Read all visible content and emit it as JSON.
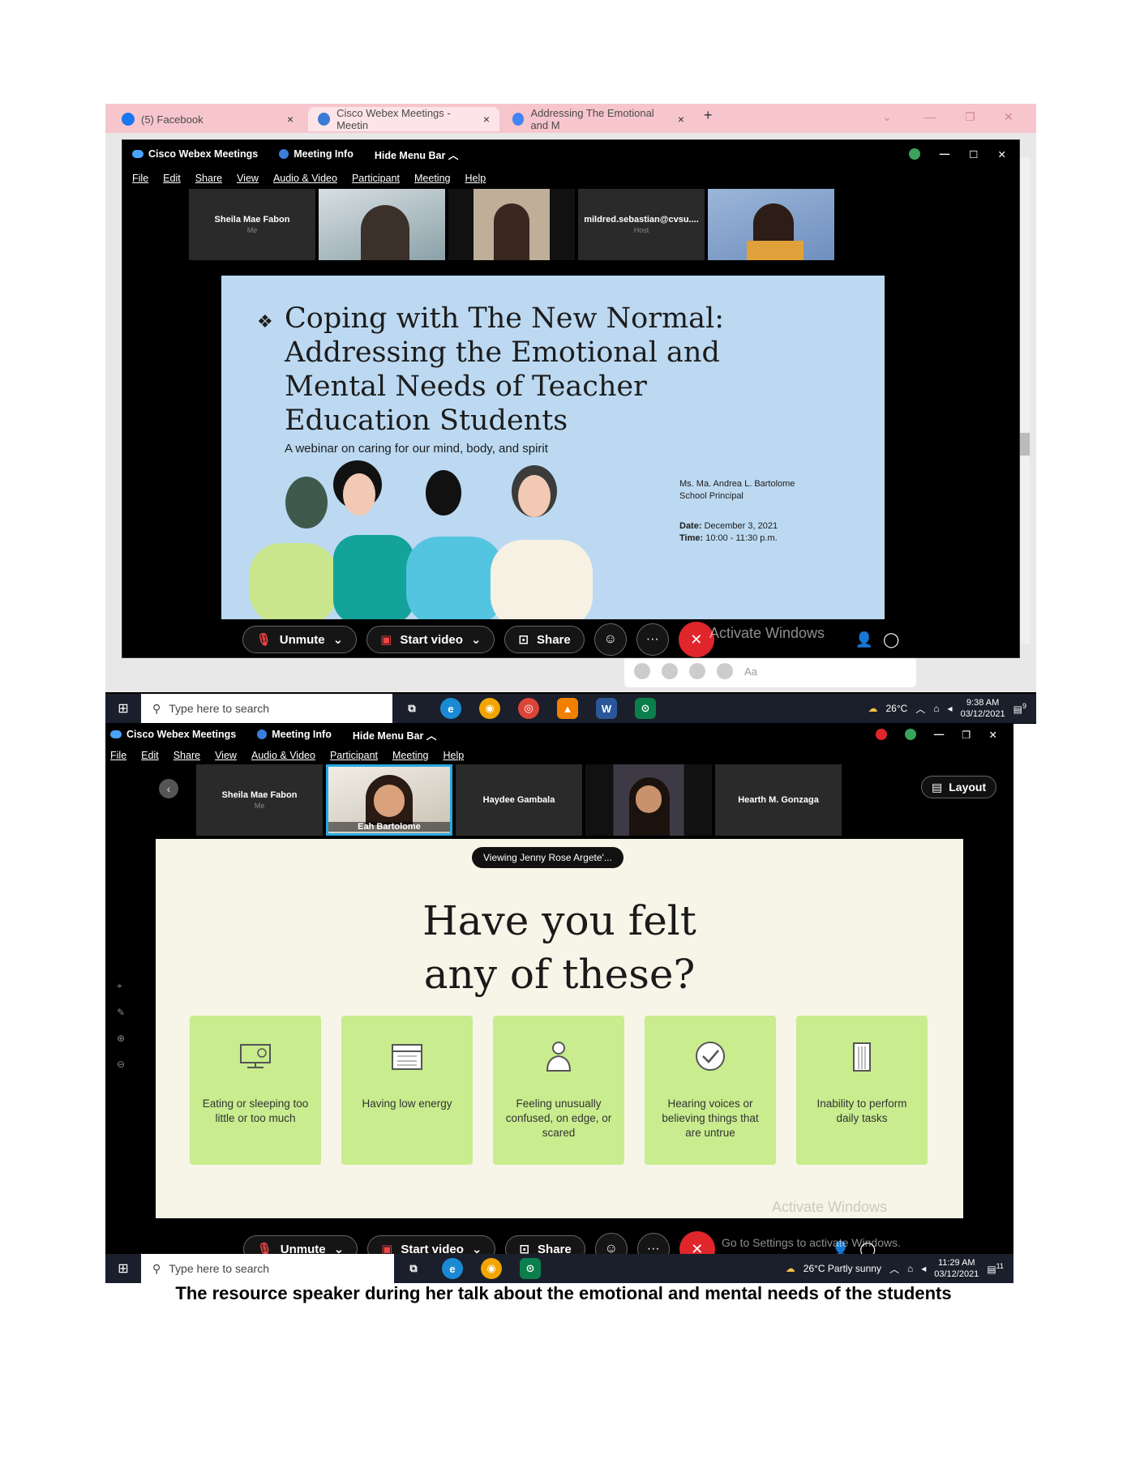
{
  "shot1": {
    "tabs": [
      {
        "label": "(5) Facebook",
        "color": "#1877f2"
      },
      {
        "label": "Cisco Webex Meetings - Meetin",
        "color": "#3a7bd5"
      },
      {
        "label": "Addressing The Emotional and M",
        "color": "#4285f4"
      }
    ],
    "new_tab": "+",
    "close_glyph": "×",
    "webex": {
      "app_name": "Cisco Webex Meetings",
      "meeting_info": "Meeting Info",
      "hide_menu_bar": "Hide Menu Bar",
      "menu": [
        "File",
        "Edit",
        "Share",
        "View",
        "Audio & Video",
        "Participant",
        "Meeting",
        "Help"
      ],
      "participants": [
        {
          "name": "Sheila Mae Fabon",
          "sub": "Me"
        },
        {
          "name": "mildred.sebastian@cvsu....",
          "sub": "Host"
        }
      ]
    },
    "slide": {
      "bullet": "❖",
      "title_lines": [
        "Coping with The New Normal:",
        "Addressing the Emotional and",
        "Mental Needs of Teacher",
        "Education Students"
      ],
      "subtitle": "A webinar on caring for our mind, body, and spirit",
      "speaker_name": "Ms. Ma. Andrea L. Bartolome",
      "speaker_role": "School Principal",
      "date_label": "Date:",
      "date_value": "December 3, 2021",
      "time_label": "Time:",
      "time_value": "10:00 - 11:30 p.m."
    },
    "controls": {
      "unmute": "Unmute",
      "start_video": "Start video",
      "share": "Share",
      "more": "···"
    },
    "activate_windows": "Activate Windows",
    "fb_input_placeholder": "Aa",
    "taskbar": {
      "search_placeholder": "Type here to search",
      "temperature": "26°C",
      "time": "9:38 AM",
      "date": "03/12/2021",
      "notif_count": "9"
    }
  },
  "shot2": {
    "webex": {
      "app_name": "Cisco Webex Meetings",
      "meeting_info": "Meeting Info",
      "hide_menu_bar": "Hide Menu Bar",
      "menu": [
        "File",
        "Edit",
        "Share",
        "View",
        "Audio & Video",
        "Participant",
        "Meeting",
        "Help"
      ],
      "participants": [
        {
          "name": "Sheila Mae Fabon",
          "sub": "Me"
        },
        {
          "name": "Eah Bartolome",
          "sub": ""
        },
        {
          "name": "Haydee Gambala",
          "sub": ""
        },
        {
          "name": "Hearth M. Gonzaga",
          "sub": ""
        }
      ],
      "layout": "Layout",
      "viewing": "Viewing Jenny Rose Argete'..."
    },
    "slide": {
      "title_lines": [
        "Have you felt",
        "any of these?"
      ],
      "cards": [
        "Eating or sleeping too little or too much",
        "Having low energy",
        "Feeling unusually confused, on edge, or scared",
        "Hearing voices or believing things that are untrue",
        "Inability to perform daily tasks"
      ]
    },
    "controls": {
      "unmute": "Unmute",
      "start_video": "Start video",
      "share": "Share",
      "more": "···"
    },
    "activate_windows": "Activate Windows",
    "activate_windows_sub": "Go to Settings to activate Windows.",
    "taskbar": {
      "search_placeholder": "Type here to search",
      "weather": "26°C  Partly sunny",
      "time": "11:29 AM",
      "date": "03/12/2021",
      "notif_count": "11"
    }
  },
  "caption": "The resource speaker during her talk about the emotional and mental needs of the students"
}
